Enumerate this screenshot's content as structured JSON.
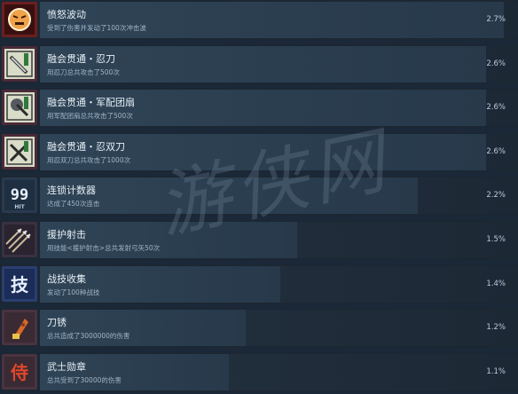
{
  "watermark": "游侠网",
  "achievements": [
    {
      "title": "愤怒波动",
      "desc": "受到了伤害并发动了100次冲击波",
      "percent": "2.7%",
      "rate": 0.027,
      "icon": "angry-face-icon"
    },
    {
      "title": "融会贯通・忍刀",
      "desc": "用忍刀总共攻击了500次",
      "percent": "2.6%",
      "rate": 0.026,
      "icon": "ninja-sword-icon"
    },
    {
      "title": "融会贯通・军配团扇",
      "desc": "用军配团扇总共攻击了500次",
      "percent": "2.6%",
      "rate": 0.026,
      "icon": "war-fan-icon"
    },
    {
      "title": "融会贯通・忍双刀",
      "desc": "用忍双刀总共攻击了1000次",
      "percent": "2.6%",
      "rate": 0.026,
      "icon": "twin-blades-icon"
    },
    {
      "title": "连锁计数器",
      "desc": "达成了450次连击",
      "percent": "2.2%",
      "rate": 0.022,
      "icon": "hit-counter-icon"
    },
    {
      "title": "援护射击",
      "desc": "用技能<援护射击>总共发射弓矢50次",
      "percent": "1.5%",
      "rate": 0.015,
      "icon": "arrows-icon"
    },
    {
      "title": "战技收集",
      "desc": "发动了100种战技",
      "percent": "1.4%",
      "rate": 0.014,
      "icon": "skill-kanji-icon"
    },
    {
      "title": "刀锈",
      "desc": "总共造成了3000000的伤害",
      "percent": "1.2%",
      "rate": 0.012,
      "icon": "rusty-blade-icon"
    },
    {
      "title": "武士勋章",
      "desc": "总共受到了30000的伤害",
      "percent": "1.1%",
      "rate": 0.011,
      "icon": "samurai-kanji-icon"
    }
  ],
  "icon_glyphs": {
    "hit_number": "99",
    "hit_label": "HIT",
    "skill_char": "技",
    "samurai_char": "侍"
  },
  "colors": {
    "row_bar": "#2f4456",
    "title": "#e6eef5",
    "desc": "#9fb4c6"
  }
}
